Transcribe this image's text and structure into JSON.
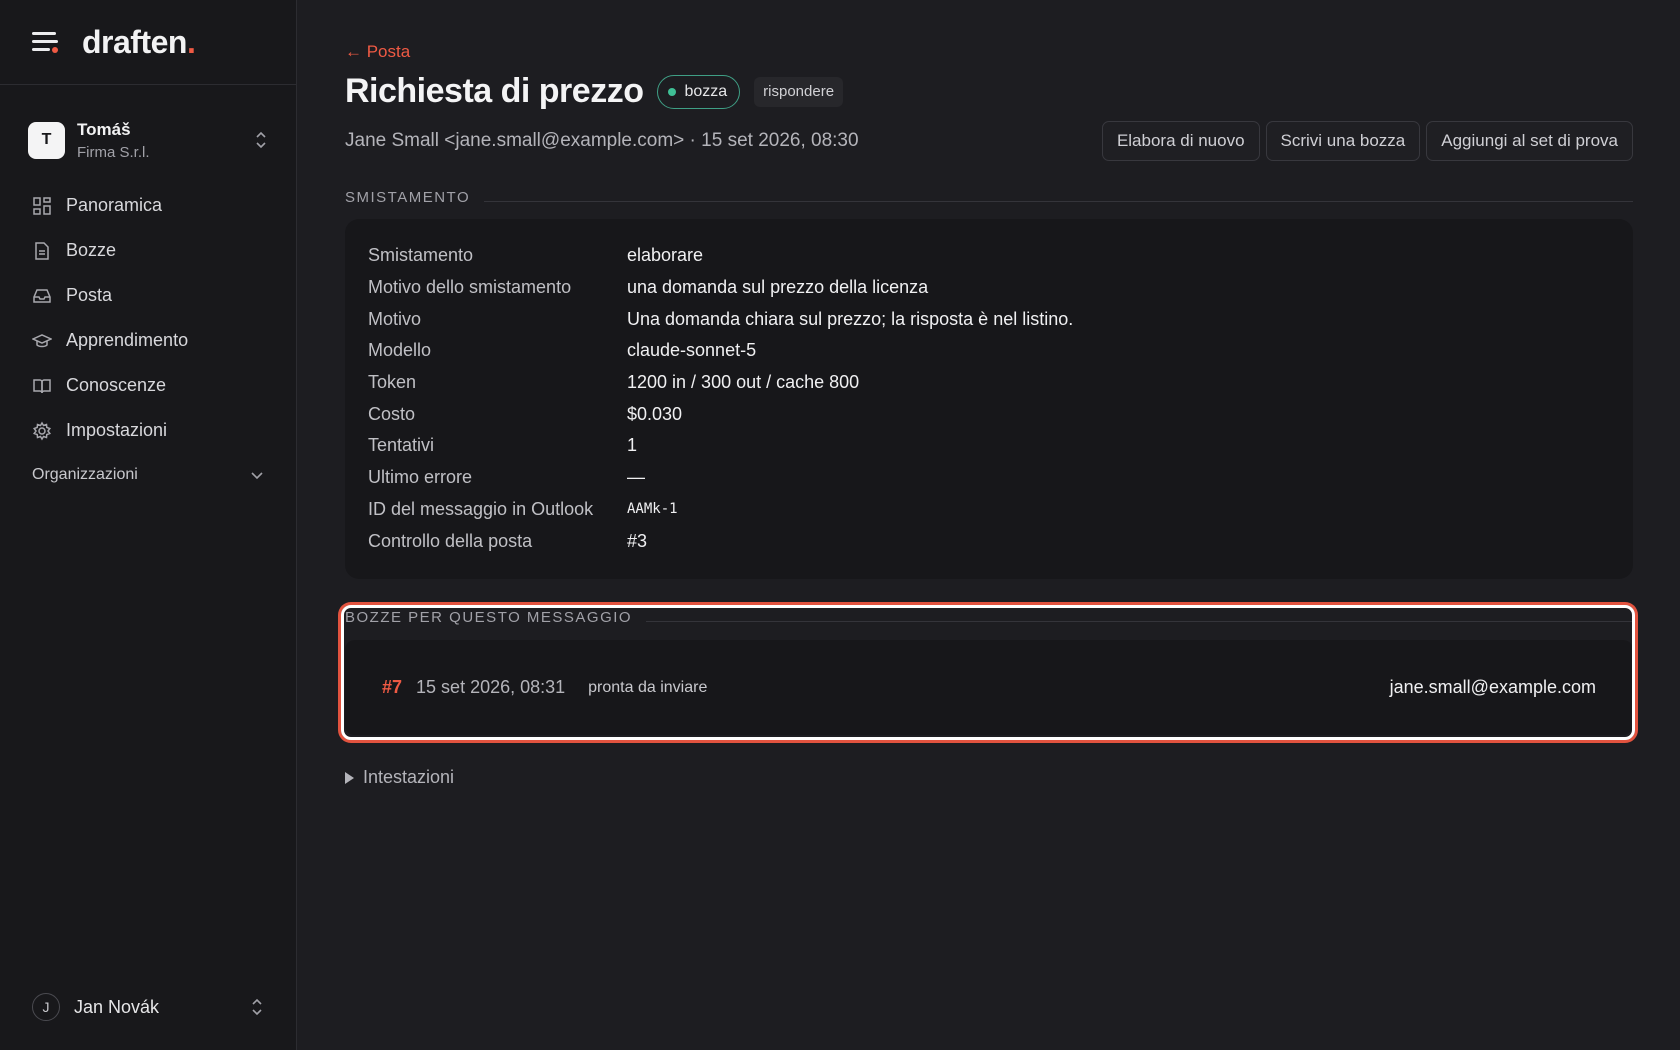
{
  "brand": {
    "name": "draften",
    "dot": ".",
    "accent": "#ef5a44"
  },
  "account": {
    "initial": "T",
    "name": "Tomáš",
    "org": "Firma S.r.l."
  },
  "nav": [
    {
      "label": "Panoramica",
      "icon": "grid-icon"
    },
    {
      "label": "Bozze",
      "icon": "document-icon"
    },
    {
      "label": "Posta",
      "icon": "inbox-icon"
    },
    {
      "label": "Apprendimento",
      "icon": "graduation-cap-icon"
    },
    {
      "label": "Conoscenze",
      "icon": "book-icon"
    },
    {
      "label": "Impostazioni",
      "icon": "gear-icon"
    }
  ],
  "organizations_label": "Organizzazioni",
  "user": {
    "initial": "J",
    "name": "Jan Novák"
  },
  "page": {
    "back_label": "← Posta",
    "title": "Richiesta di prezzo",
    "status_badge": "bozza",
    "status_color": "#3fbf95",
    "type_badge": "rispondere",
    "meta": "Jane Small <jane.small@example.com> · 15 set 2026, 08:30",
    "actions": [
      "Elabora di nuovo",
      "Scrivi una bozza",
      "Aggiungi al set di prova"
    ]
  },
  "triage": {
    "heading": "SMISTAMENTO",
    "rows": [
      {
        "key": "Smistamento",
        "value": "elaborare"
      },
      {
        "key": "Motivo dello smistamento",
        "value": "una domanda sul prezzo della licenza"
      },
      {
        "key": "Motivo",
        "value": "Una domanda chiara sul prezzo; la risposta è nel listino."
      },
      {
        "key": "Modello",
        "value": "claude-sonnet-5"
      },
      {
        "key": "Token",
        "value": "1200 in / 300 out / cache 800"
      },
      {
        "key": "Costo",
        "value": "$0.030"
      },
      {
        "key": "Tentativi",
        "value": "1"
      },
      {
        "key": "Ultimo errore",
        "value": "—"
      },
      {
        "key": "ID del messaggio in Outlook",
        "value": "AAMk-1"
      },
      {
        "key": "Controllo della posta",
        "value": "#3"
      }
    ]
  },
  "drafts": {
    "heading": "BOZZE PER QUESTO MESSAGGIO",
    "items": [
      {
        "number": "#7",
        "date": "15 set 2026, 08:31",
        "state": "pronta da inviare",
        "to": "jane.small@example.com"
      }
    ]
  },
  "headers_label": "Intestazioni"
}
